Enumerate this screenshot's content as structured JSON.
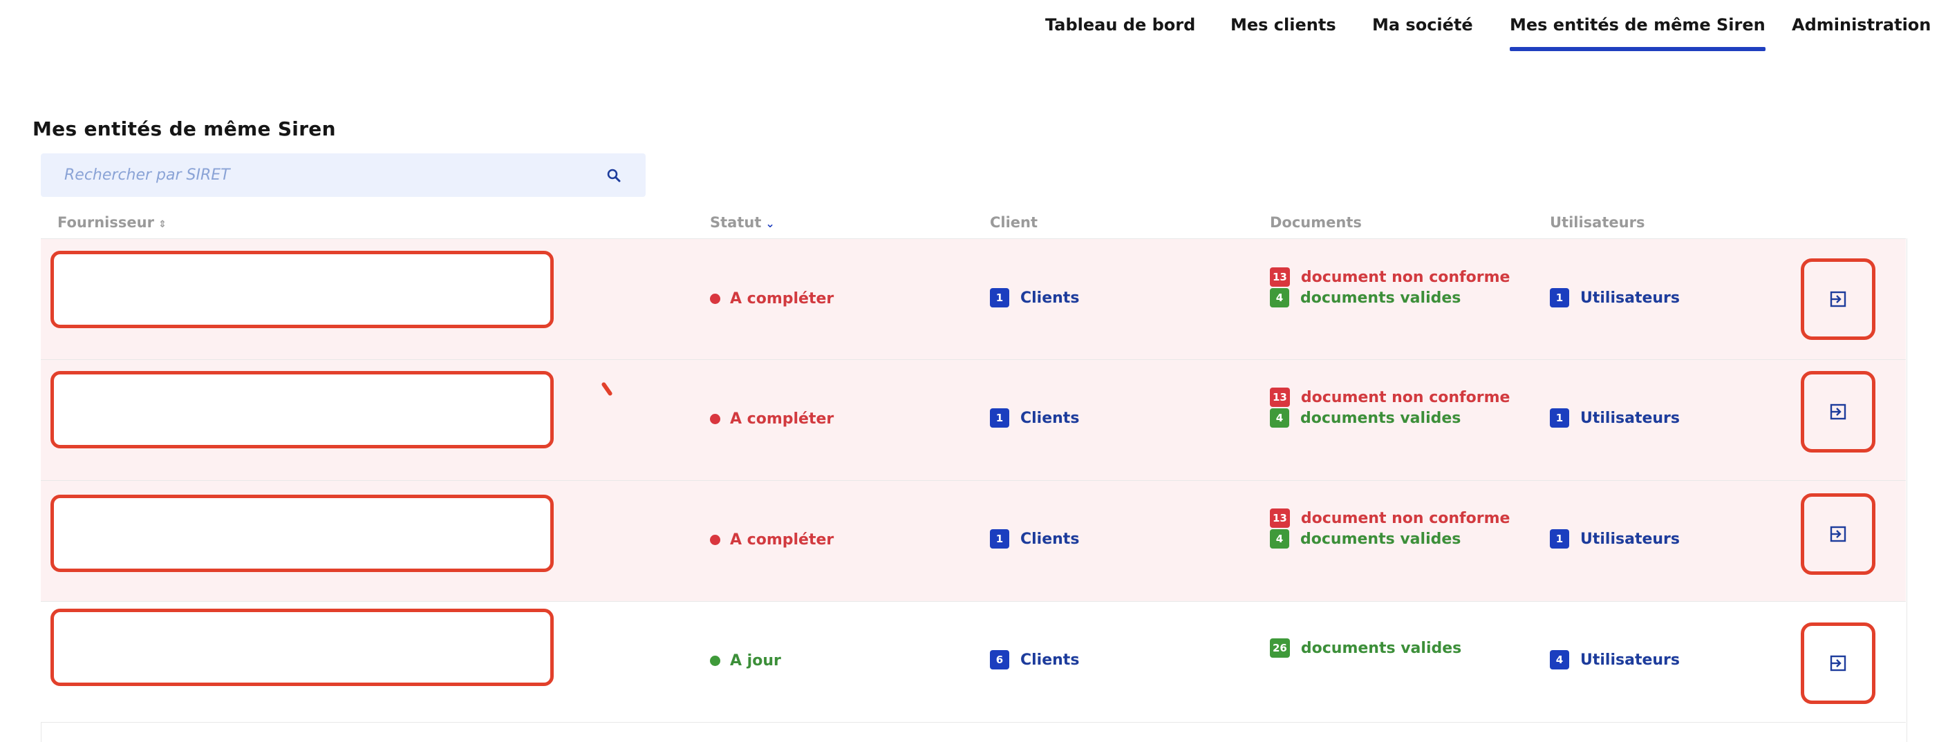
{
  "nav": {
    "items": [
      {
        "label": "Tableau de bord"
      },
      {
        "label": "Mes clients"
      },
      {
        "label": "Ma société"
      },
      {
        "label": "Mes entités de même Siren",
        "active": true
      },
      {
        "label": "Administration"
      }
    ]
  },
  "page": {
    "title": "Mes entités de même Siren"
  },
  "search": {
    "placeholder": "Rechercher par SIRET",
    "value": ""
  },
  "table": {
    "headers": {
      "supplier": "Fournisseur",
      "status": "Statut",
      "client": "Client",
      "documents": "Documents",
      "users": "Utilisateurs"
    },
    "rows": [
      {
        "status": "A compléter",
        "status_color": "#d9363e",
        "clients_count": "1",
        "clients_label": "Clients",
        "docs_nonconform_count": "13",
        "docs_nonconform_label": "document non conforme",
        "docs_valid_count": "4",
        "docs_valid_label": "documents valides",
        "users_count": "1",
        "users_label": "Utilisateurs"
      },
      {
        "status": "A compléter",
        "status_color": "#d9363e",
        "clients_count": "1",
        "clients_label": "Clients",
        "docs_nonconform_count": "13",
        "docs_nonconform_label": "document non conforme",
        "docs_valid_count": "4",
        "docs_valid_label": "documents valides",
        "users_count": "1",
        "users_label": "Utilisateurs"
      },
      {
        "status": "A compléter",
        "status_color": "#d9363e",
        "clients_count": "1",
        "clients_label": "Clients",
        "docs_nonconform_count": "13",
        "docs_nonconform_label": "document non conforme",
        "docs_valid_count": "4",
        "docs_valid_label": "documents valides",
        "users_count": "1",
        "users_label": "Utilisateurs"
      },
      {
        "status": "A jour",
        "status_color": "#3f9a3a",
        "clients_count": "6",
        "clients_label": "Clients",
        "docs_valid_count": "26",
        "docs_valid_label": "documents valides",
        "users_count": "4",
        "users_label": "Utilisateurs"
      }
    ]
  },
  "colors": {
    "accent": "#1f3fbf",
    "alert_row": "#fdf1f2",
    "highlight": "#e2402b"
  },
  "icons": {
    "search": "search-icon",
    "action": "login-arrow-icon",
    "sort": "sort-icon",
    "caret": "chevron-down-icon"
  }
}
